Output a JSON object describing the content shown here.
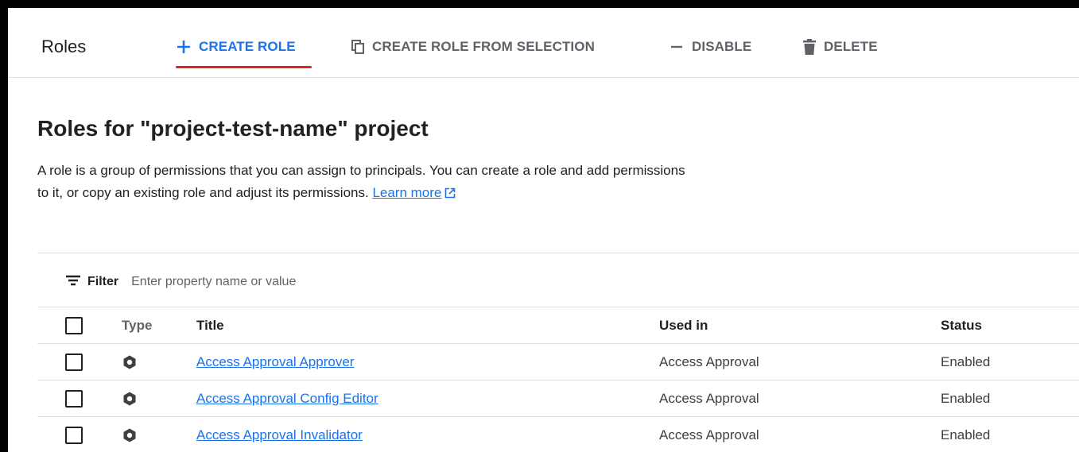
{
  "toolbar": {
    "page_name": "Roles",
    "create_role": "CREATE ROLE",
    "create_from_selection": "CREATE ROLE FROM SELECTION",
    "disable": "DISABLE",
    "delete": "DELETE",
    "accent_color": "#1a73e8",
    "active_underline_color": "#e52222"
  },
  "main": {
    "heading": "Roles for \"project-test-name\" project",
    "description": "A role is a group of permissions that you can assign to principals. You can create a role and add permissions to it, or copy an existing role and adjust its permissions.",
    "learn_more": "Learn more"
  },
  "filter": {
    "label": "Filter",
    "placeholder": "Enter property name or value"
  },
  "table": {
    "columns": {
      "type": "Type",
      "title": "Title",
      "used_in": "Used in",
      "status": "Status"
    },
    "rows": [
      {
        "type_icon": "hexagon-role-icon",
        "title": "Access Approval Approver",
        "used_in": "Access Approval",
        "status": "Enabled"
      },
      {
        "type_icon": "hexagon-role-icon",
        "title": "Access Approval Config Editor",
        "used_in": "Access Approval",
        "status": "Enabled"
      },
      {
        "type_icon": "hexagon-role-icon",
        "title": "Access Approval Invalidator",
        "used_in": "Access Approval",
        "status": "Enabled"
      }
    ]
  }
}
